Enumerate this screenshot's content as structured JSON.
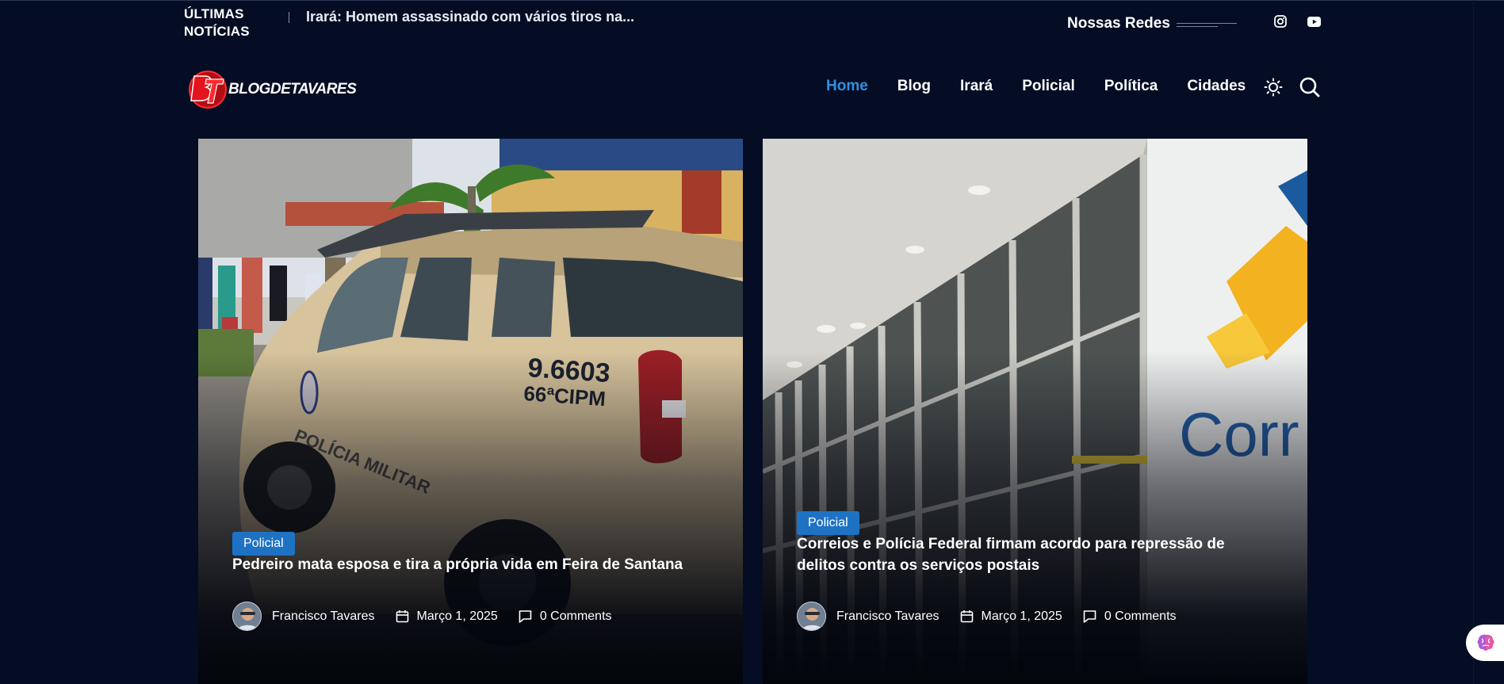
{
  "ticker": {
    "label_line1": "ÚLTIMAS",
    "label_line2": "NOTÍCIAS",
    "headline": "Irará: Homem assassinado com vários tiros na..."
  },
  "social": {
    "label": "Nossas Redes",
    "icons": [
      "instagram-icon",
      "youtube-icon"
    ]
  },
  "logo": {
    "text": "BLOGDETAVARES"
  },
  "nav": {
    "items": [
      "Home",
      "Blog",
      "Irará",
      "Policial",
      "Política",
      "Cidades"
    ],
    "active": "Home"
  },
  "header_icons": [
    "sun-icon",
    "search-icon"
  ],
  "colors": {
    "background": "#040d24",
    "accent": "#2f8fe0",
    "badge": "#1e72c4",
    "logo_red": "#e3141c"
  },
  "posts": [
    {
      "category": "Policial",
      "title": "Pedreiro mata esposa e tira a própria vida em Feira de Santana",
      "author": "Francisco Tavares",
      "date": "Março 1, 2025",
      "comments": "0 Comments"
    },
    {
      "category": "Policial",
      "title": "Correios e Polícia Federal firmam acordo para repressão de delitos contra os serviços postais",
      "author": "Francisco Tavares",
      "date": "Março 1, 2025",
      "comments": "0 Comments"
    }
  ],
  "widget": {
    "icon": "brain-icon"
  }
}
